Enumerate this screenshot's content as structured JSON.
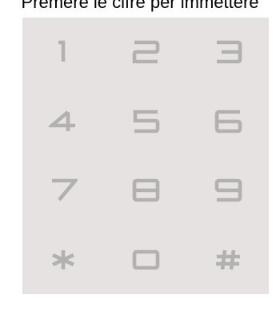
{
  "prompt": "Premere le cifre per immettere",
  "keypad": {
    "background": "#e6e2e1",
    "digit_color": "#b2b0b0",
    "keys": [
      {
        "label": "1"
      },
      {
        "label": "2"
      },
      {
        "label": "3"
      },
      {
        "label": "4"
      },
      {
        "label": "5"
      },
      {
        "label": "6"
      },
      {
        "label": "7"
      },
      {
        "label": "8"
      },
      {
        "label": "9"
      },
      {
        "label": "*"
      },
      {
        "label": "0"
      },
      {
        "label": "#"
      }
    ]
  }
}
